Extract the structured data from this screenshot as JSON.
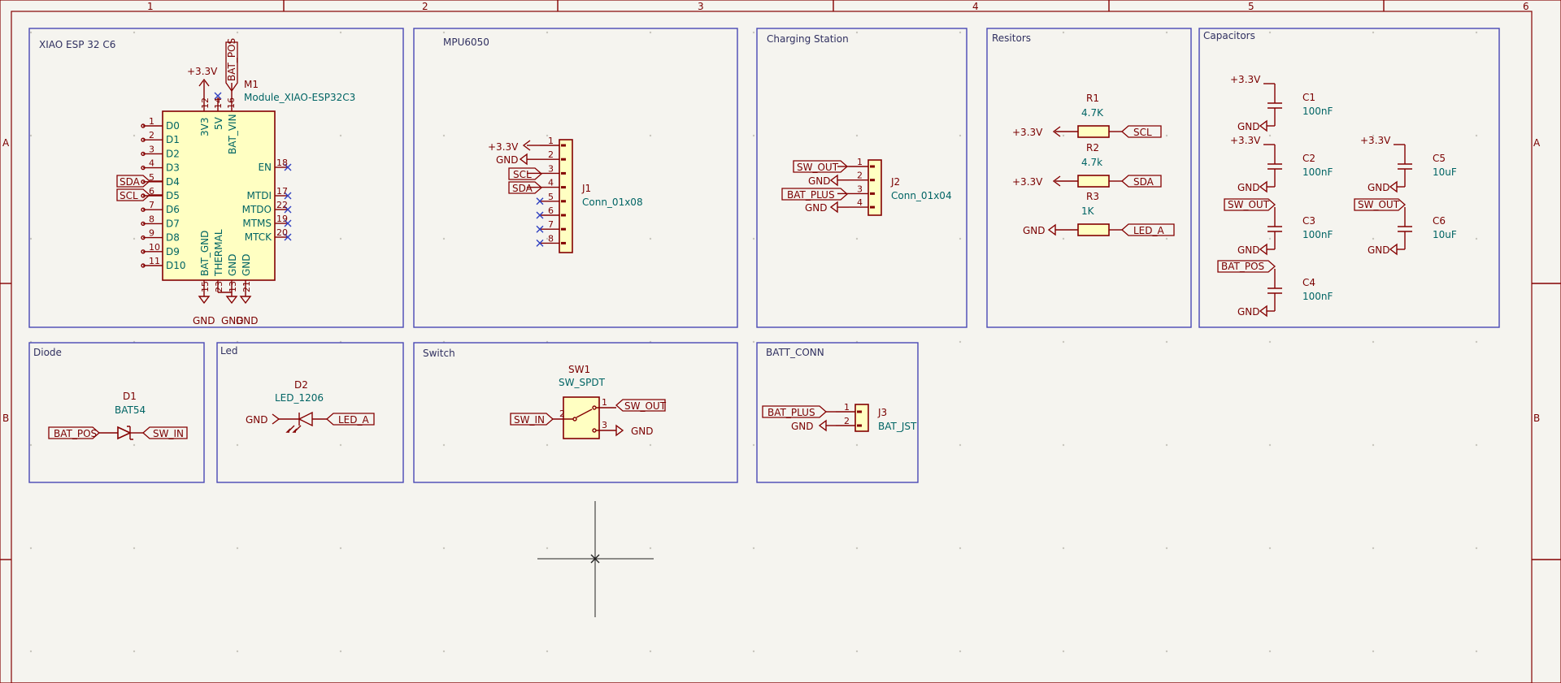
{
  "frame": {
    "cols": [
      "1",
      "2",
      "3",
      "4",
      "5",
      "6"
    ],
    "rows": [
      "A",
      "B"
    ]
  },
  "blocks": {
    "xiao": "XIAO ESP 32 C6",
    "mpu": "MPU6050",
    "charging": "Charging Station",
    "resistors": "Resitors",
    "capacitors": "Capacitors",
    "diode": "Diode",
    "led": "Led",
    "switch": "Switch",
    "batt": "BATT_CONN"
  },
  "m1": {
    "ref": "M1",
    "value": "Module_XIAO-ESP32C3",
    "left_pins": [
      {
        "num": "1",
        "name": "D0"
      },
      {
        "num": "2",
        "name": "D1"
      },
      {
        "num": "3",
        "name": "D2"
      },
      {
        "num": "4",
        "name": "D3"
      },
      {
        "num": "5",
        "name": "D4"
      },
      {
        "num": "6",
        "name": "D5"
      },
      {
        "num": "7",
        "name": "D6"
      },
      {
        "num": "8",
        "name": "D7"
      },
      {
        "num": "9",
        "name": "D8"
      },
      {
        "num": "10",
        "name": "D9"
      },
      {
        "num": "11",
        "name": "D10"
      }
    ],
    "right_pins": [
      {
        "num": "18",
        "name": "EN"
      },
      {
        "num": "17",
        "name": "MTDI"
      },
      {
        "num": "22",
        "name": "MTDO"
      },
      {
        "num": "19",
        "name": "MTMS"
      },
      {
        "num": "20",
        "name": "MTCK"
      }
    ],
    "top_pins": [
      {
        "num": "12",
        "name": "3V3"
      },
      {
        "num": "14",
        "name": "5V"
      },
      {
        "num": "16",
        "name": "BAT_VIN"
      }
    ],
    "bottom_pins": [
      {
        "num": "15",
        "name": "BAT_GND"
      },
      {
        "num": "23",
        "name": "THERMAL"
      },
      {
        "num": "13",
        "name": "GND"
      },
      {
        "num": "21",
        "name": "GND"
      }
    ],
    "power": "+3.3V",
    "bat_pos": "BAT_POS",
    "sda": "SDA",
    "scl": "SCL",
    "gnd": [
      "GND",
      "GND",
      "GND"
    ]
  },
  "j1": {
    "ref": "J1",
    "value": "Conn_01x08",
    "pins": [
      "1",
      "2",
      "3",
      "4",
      "5",
      "6",
      "7",
      "8"
    ],
    "nets": [
      "+3.3V",
      "GND",
      "SCL",
      "SDA"
    ]
  },
  "j2": {
    "ref": "J2",
    "value": "Conn_01x04",
    "pins": [
      "1",
      "2",
      "3",
      "4"
    ],
    "nets": [
      "SW_OUT",
      "GND",
      "BAT_PLUS",
      "GND"
    ]
  },
  "r1": {
    "ref": "R1",
    "value": "4.7K",
    "left": "+3.3V",
    "right": "SCL"
  },
  "r2": {
    "ref": "R2",
    "value": "4.7k",
    "left": "+3.3V",
    "right": "SDA"
  },
  "r3": {
    "ref": "R3",
    "value": "1K",
    "left": "GND",
    "right": "LED_A"
  },
  "caps": [
    {
      "ref": "C1",
      "value": "100nF",
      "top": "+3.3V",
      "bot": "GND"
    },
    {
      "ref": "C2",
      "value": "100nF",
      "top": "+3.3V",
      "bot": "GND"
    },
    {
      "ref": "C3",
      "value": "100nF",
      "top": "SW_OUT",
      "bot": "GND"
    },
    {
      "ref": "C4",
      "value": "100nF",
      "top": "BAT_POS",
      "bot": "GND"
    },
    {
      "ref": "C5",
      "value": "10uF",
      "top": "+3.3V",
      "bot": "GND"
    },
    {
      "ref": "C6",
      "value": "10uF",
      "top": "SW_OUT",
      "bot": "GND"
    }
  ],
  "d1": {
    "ref": "D1",
    "value": "BAT54",
    "left": "BAT_POS",
    "right": "SW_IN"
  },
  "d2": {
    "ref": "D2",
    "value": "LED_1206",
    "left": "GND",
    "right": "LED_A"
  },
  "sw1": {
    "ref": "SW1",
    "value": "SW_SPDT",
    "in": "SW_IN",
    "out": "SW_OUT",
    "gnd": "GND",
    "pins": [
      "2",
      "1",
      "3"
    ]
  },
  "j3": {
    "ref": "J3",
    "value": "BAT_JST",
    "pins": [
      "1",
      "2"
    ],
    "nets": [
      "BAT_PLUS",
      "GND"
    ]
  }
}
